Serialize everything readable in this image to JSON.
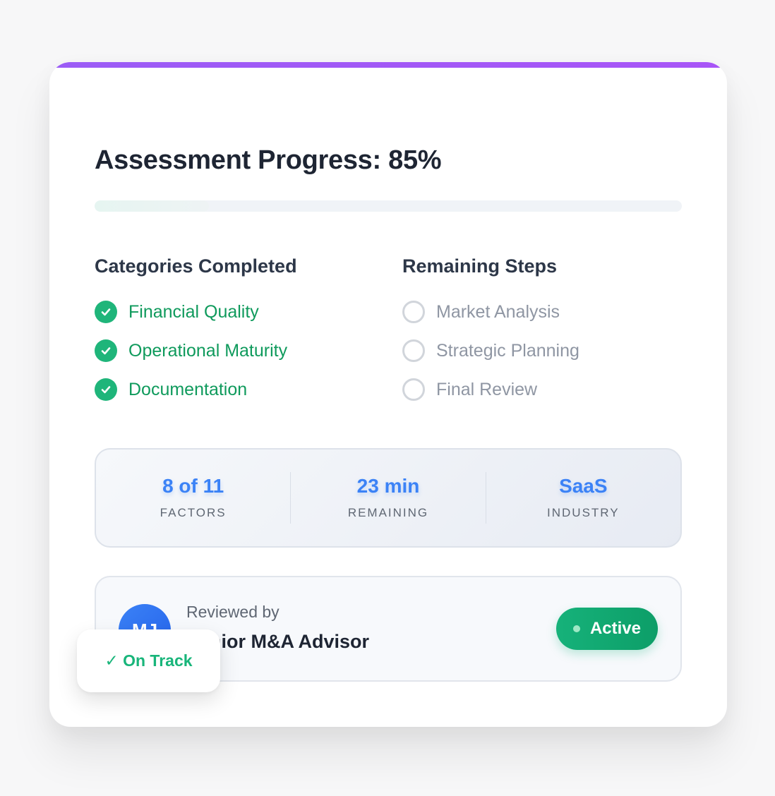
{
  "title": "Assessment Progress: 85%",
  "progress": {
    "percent": 85
  },
  "completed": {
    "heading": "Categories Completed",
    "items": [
      "Financial Quality",
      "Operational Maturity",
      "Documentation"
    ]
  },
  "remaining": {
    "heading": "Remaining Steps",
    "items": [
      "Market Analysis",
      "Strategic Planning",
      "Final Review"
    ]
  },
  "stats": [
    {
      "value": "8 of 11",
      "label": "FACTORS"
    },
    {
      "value": "23 min",
      "label": "REMAINING"
    },
    {
      "value": "SaaS",
      "label": "INDUSTRY"
    }
  ],
  "reviewer": {
    "initials": "MJ",
    "label": "Reviewed by",
    "name": "Senior M&A Advisor",
    "status": "Active"
  },
  "badge": {
    "text": "✓ On Track"
  },
  "colors": {
    "accent": "#a855f7",
    "success": "#1fb57a",
    "stat_blue": "#3b82f6"
  }
}
